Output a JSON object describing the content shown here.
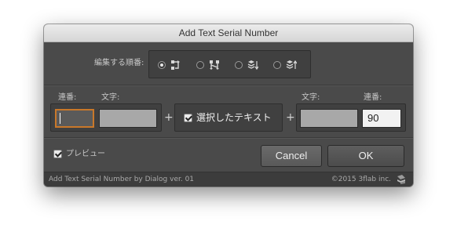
{
  "window": {
    "title": "Add Text Serial Number"
  },
  "order": {
    "label": "編集する順番:",
    "options": [
      {
        "icon": "order-left-to-right-icon",
        "selected": true
      },
      {
        "icon": "order-top-to-bottom-icon",
        "selected": false
      },
      {
        "icon": "layer-stack-down-icon",
        "selected": false
      },
      {
        "icon": "layer-stack-up-icon",
        "selected": false
      }
    ]
  },
  "prefix": {
    "number_label": "連番:",
    "text_label": "文字:",
    "number_value": "",
    "text_value": ""
  },
  "middle": {
    "checkbox_label": "選択したテキスト",
    "checked": true,
    "plus": "+"
  },
  "suffix": {
    "text_label": "文字:",
    "number_label": "連番:",
    "text_value": "",
    "number_value": "90"
  },
  "preview": {
    "label": "プレビュー",
    "checked": true
  },
  "buttons": {
    "cancel": "Cancel",
    "ok": "OK"
  },
  "footer": {
    "left": "Add Text Serial Number by Dialog ver. 01",
    "right": "©2015 3flab inc."
  },
  "colors": {
    "dialog_bg": "#4a4a4a",
    "focus_ring": "#c9782a",
    "title_bar": "#e0e0e0"
  }
}
